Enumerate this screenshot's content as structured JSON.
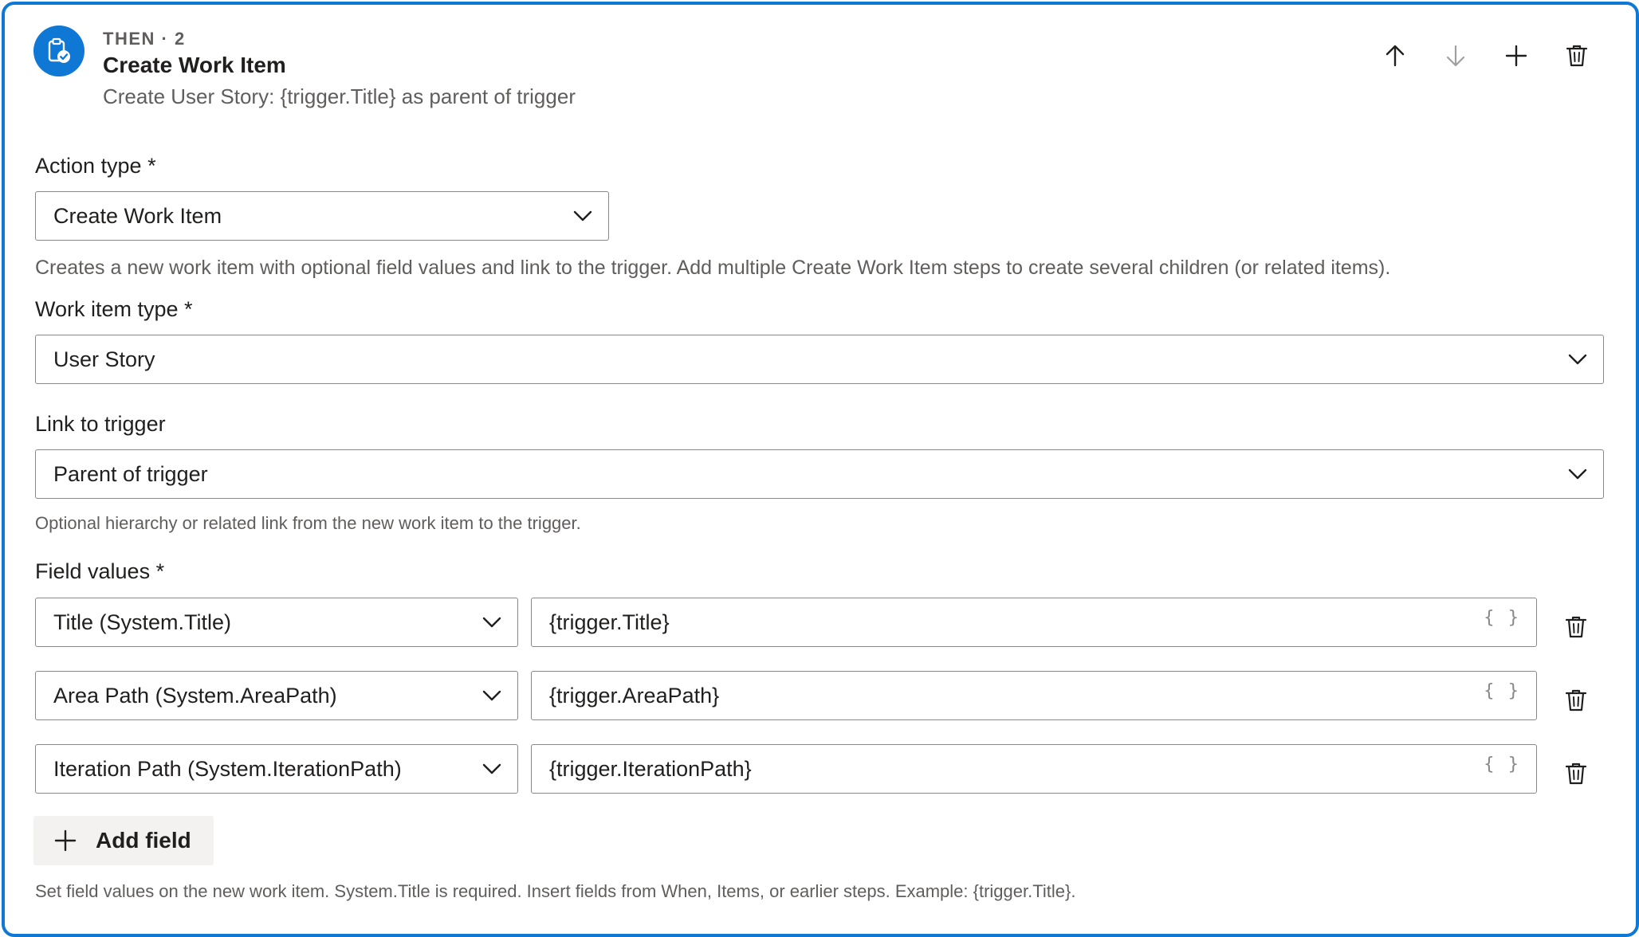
{
  "header": {
    "kicker": "THEN · 2",
    "title": "Create Work Item",
    "summary": "Create User Story: {trigger.Title} as parent of trigger",
    "icon": "clipboard-check-icon",
    "actions": [
      "move-up",
      "move-down",
      "add-step",
      "delete-step"
    ]
  },
  "action_type": {
    "label": "Action type *",
    "value": "Create Work Item",
    "help": "Creates a new work item with optional field values and link to the trigger. Add multiple Create Work Item steps to create several children (or related items)."
  },
  "work_item_type": {
    "label": "Work item type *",
    "value": "User Story"
  },
  "link_to_trigger": {
    "label": "Link to trigger",
    "value": "Parent of trigger",
    "help": "Optional hierarchy or related link from the new work item to the trigger."
  },
  "field_values": {
    "label": "Field values *",
    "rows": [
      {
        "field": "Title (System.Title)",
        "value": "{trigger.Title}",
        "insert_label": "{ }"
      },
      {
        "field": "Area Path (System.AreaPath)",
        "value": "{trigger.AreaPath}",
        "insert_label": "{ }"
      },
      {
        "field": "Iteration Path (System.IterationPath)",
        "value": "{trigger.IterationPath}",
        "insert_label": "{ }"
      }
    ],
    "add_label": "Add field",
    "help": "Set field values on the new work item. System.Title is required. Insert fields from When, Items, or earlier steps. Example: {trigger.Title}."
  },
  "colors": {
    "accent": "#0f78d4",
    "text": "#201f1e",
    "secondary_text": "#605e5c",
    "border": "#8a8886",
    "button_bg": "#f3f2f1"
  }
}
